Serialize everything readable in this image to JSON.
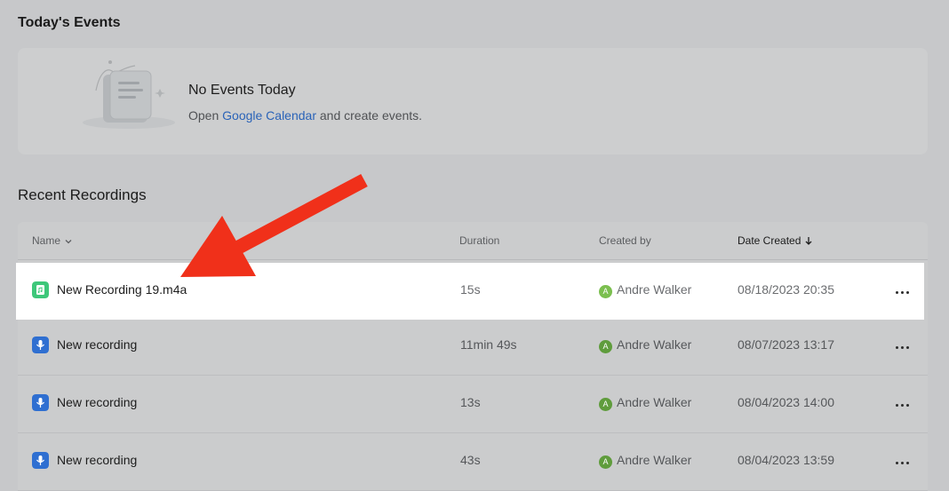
{
  "events": {
    "title": "Today's Events",
    "empty_title": "No Events Today",
    "empty_prefix": "Open ",
    "empty_link": "Google Calendar",
    "empty_suffix": " and create events."
  },
  "recordings": {
    "title": "Recent Recordings",
    "columns": {
      "name": "Name",
      "duration": "Duration",
      "created_by": "Created by",
      "date_created": "Date Created"
    },
    "rows": [
      {
        "name": "New Recording 19.m4a",
        "icon": "audio-file-icon",
        "duration": "15s",
        "creator_initial": "A",
        "creator": "Andre Walker",
        "date": "08/18/2023 20:35"
      },
      {
        "name": "New recording",
        "icon": "microphone-icon",
        "duration": "11min 49s",
        "creator_initial": "A",
        "creator": "Andre Walker",
        "date": "08/07/2023 13:17"
      },
      {
        "name": "New recording",
        "icon": "microphone-icon",
        "duration": "13s",
        "creator_initial": "A",
        "creator": "Andre Walker",
        "date": "08/04/2023 14:00"
      },
      {
        "name": "New recording",
        "icon": "microphone-icon",
        "duration": "43s",
        "creator_initial": "A",
        "creator": "Andre Walker",
        "date": "08/04/2023 13:59"
      }
    ]
  },
  "colors": {
    "overlay_bg": "#c7c8ca",
    "link": "#2a63b8",
    "annotation_arrow": "#f0301a",
    "audio_icon": "#3ec77a",
    "mic_icon": "#2f6fd1",
    "avatar": "#5f9c3c"
  }
}
